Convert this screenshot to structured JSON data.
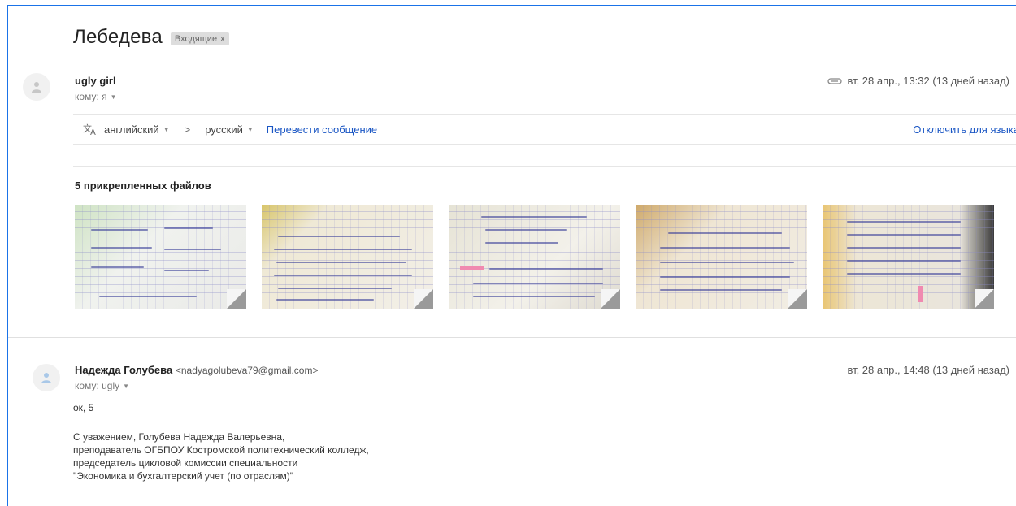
{
  "subject": "Лебедева",
  "label": {
    "text": "Входящие",
    "close": "x"
  },
  "message1": {
    "sender": "ugly girl",
    "to": "кому: я",
    "date": "вт, 28 апр., 13:32 (13 дней назад)",
    "icons": {
      "avatar": "person-icon",
      "attachment": "paperclip-icon"
    }
  },
  "translate": {
    "icon": "translate-icon",
    "from_lang": "английский",
    "arrow": ">",
    "to_lang": "русский",
    "translate_link": "Перевести сообщение",
    "disable_link": "Отключить для языка"
  },
  "attachments": {
    "title": "5 прикрепленных файлов",
    "count": 5
  },
  "message2": {
    "sender": "Надежда Голубева",
    "email": "<nadyagolubeva79@gmail.com>",
    "to": "кому: ugly",
    "date": "вт, 28 апр., 14:48 (13 дней назад)",
    "body_first": "ок, 5",
    "signature": [
      "С уважением, Голубева Надежда Валерьевна,",
      "преподаватель ОГБПОУ Костромской политехнический колледж,",
      "председатель цикловой комиссии специальности",
      "\"Экономика и бухгалтерский учет (по отраслям)\""
    ]
  }
}
